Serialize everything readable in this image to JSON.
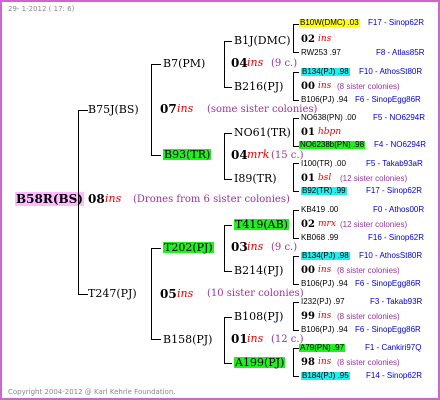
{
  "header": {
    "date": "29- 1-2012 ( 17: 6)"
  },
  "footer": {
    "copyright": "Copyright 2004-2012 @ Karl Kehrle Foundation."
  },
  "root": {
    "name": "B58R(BS)",
    "gen": "08",
    "ins": "ins",
    "note": "(Drones from 6 sister colonies)"
  },
  "l1": {
    "top": {
      "name": "B75J(BS)",
      "gen": "07",
      "ins": "ins",
      "note": "(some sister colonies)"
    },
    "bot": {
      "name": "T247(PJ)",
      "gen": "05",
      "ins": "ins",
      "note": "(10 sister colonies)"
    }
  },
  "l2": {
    "a": {
      "name": "B7(PM)",
      "gen": "04",
      "ins": "ins",
      "note": "(9 c.)"
    },
    "b": {
      "name": "B93(TR)",
      "gen": "04",
      "ins": "mrk",
      "note": "(15 c.)"
    },
    "c": {
      "name": "T202(PJ)",
      "gen": "03",
      "ins": "ins",
      "note": "(9 c.)"
    },
    "d": {
      "name": "B158(PJ)",
      "gen": "01",
      "ins": "ins",
      "note": "(12 c.)"
    }
  },
  "l3": {
    "a1": "B1J(DMC)",
    "a2": "B216(PJ)",
    "b1": "NO61(TR)",
    "b2": "I89(TR)",
    "c1": "T419(AB)",
    "c2": "B214(PJ)",
    "d1": "B108(PJ)",
    "d2": "A199(PJ)"
  },
  "l4": [
    {
      "top": "B10W(DMC) .03",
      "topr": "F17 - Sinop62R",
      "gen": "02",
      "ins": "ins",
      "note": "",
      "bot": "RW253 .97",
      "botr": "F8 - Atlas85R"
    },
    {
      "top": "B134(PJ) .98",
      "topr": "F10 - AthosSt80R",
      "gen": "00",
      "ins": "ins",
      "note": "(8 sister colonies)",
      "bot": "B106(PJ) .94",
      "botr": "F6 - SinopEgg86R"
    },
    {
      "top": "NO638(PN) .00",
      "topr": "F5 - NO6294R",
      "gen": "01",
      "ins": "hbpn",
      "note": "",
      "bot": "NO6238b(PN) .98",
      "botr": "F4 - NO6294R"
    },
    {
      "top": "I100(TR) .00",
      "topr": "F5 - Takab93aR",
      "gen": "01",
      "ins": "bsl",
      "note": "(12 sister colonies)",
      "bot": "B92(TR) .99",
      "botr": "F17 - Sinop62R"
    },
    {
      "top": "KB419 .00",
      "topr": "F0 - Athos00R",
      "gen": "02",
      "ins": "mrx",
      "note": "(12 sister colonies)",
      "bot": "KB068 .99",
      "botr": "F16 - Sinop62R"
    },
    {
      "top": "B134(PJ) .98",
      "topr": "F10 - AthosSt80R",
      "gen": "00",
      "ins": "ins",
      "note": "(8 sister colonies)",
      "bot": "B106(PJ) .94",
      "botr": "F6 - SinopEgg86R"
    },
    {
      "top": "I232(PJ) .97",
      "topr": "F3 - Takab93R",
      "gen": "99",
      "ins": "ins",
      "note": "(8 sister colonies)",
      "bot": "B106(PJ) .94",
      "botr": "F6 - SinopEgg86R"
    },
    {
      "top": "A79(PN) .97",
      "topr": "F1 - Cankiri97Q",
      "gen": "98",
      "ins": "ins",
      "note": "(8 sister colonies)",
      "bot": "B184(PJ) .95",
      "botr": "F14 - Sinop62R"
    }
  ]
}
